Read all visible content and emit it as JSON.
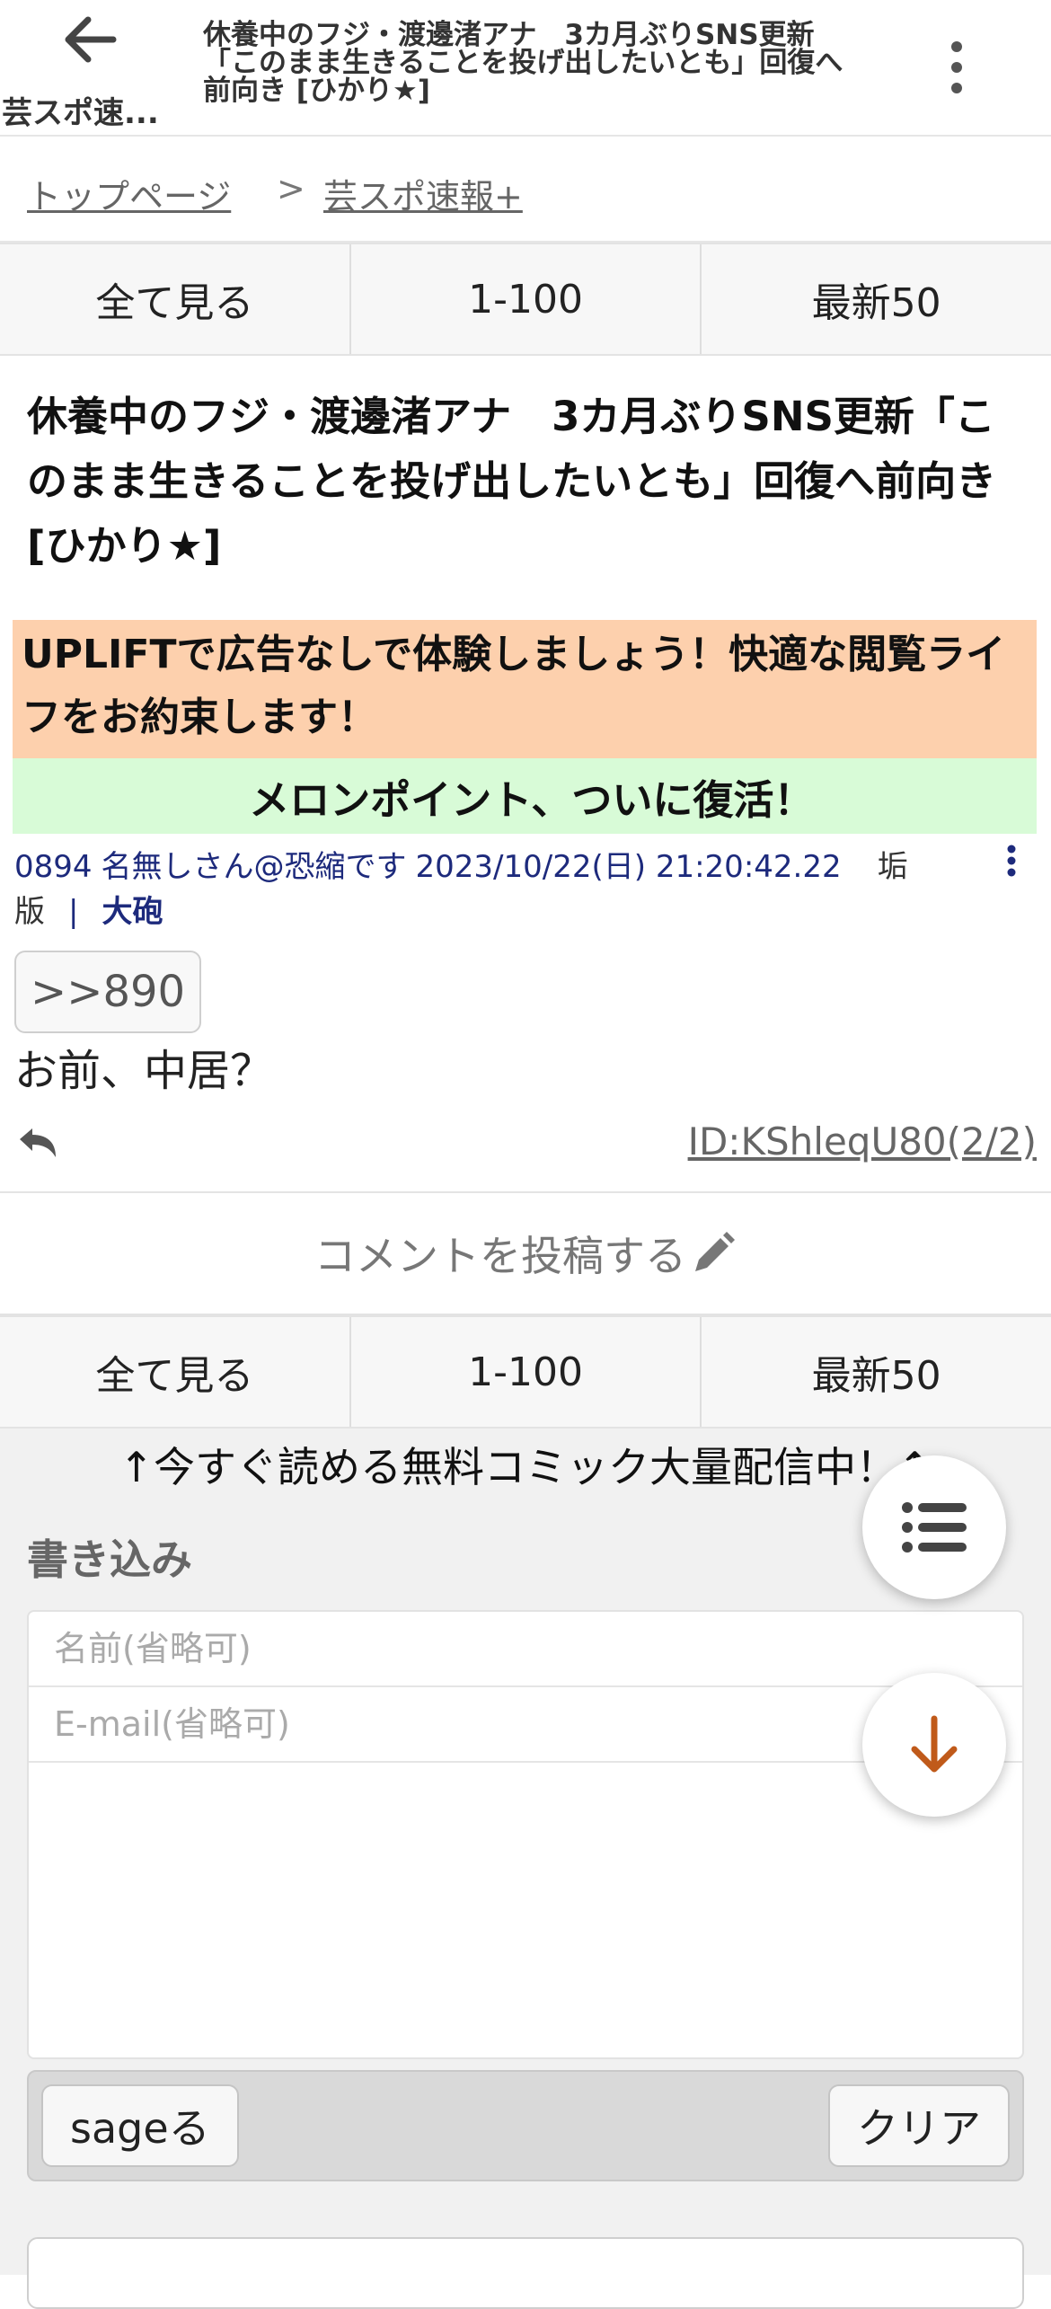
{
  "header": {
    "board_short": "芸スポ速...",
    "title": "休養中のフジ・渡邊渚アナ　3カ月ぶりSNS更新「このまま生きることを投げ出したいとも」回復へ前向き [ひかり★]"
  },
  "breadcrumb": {
    "home": "トップページ",
    "separator": ">",
    "board": "芸スポ速報+"
  },
  "nav": {
    "all": "全て見る",
    "range": "1-100",
    "latest": "最新50"
  },
  "thread": {
    "title": "休養中のフジ・渡邊渚アナ　3カ月ぶりSNS更新「このまま生きることを投げ出したいとも」回復へ前向き [ひかり★]"
  },
  "promo": {
    "uplift": "UPLIFTで広告なしで体験しましょう！快適な閲覧ライフをお約束します！",
    "melon": "󠄀󠄀 󠄀メロンポイント、ついに復活！󠄀󠄀"
  },
  "post": {
    "number": "0894",
    "name": "名無しさん@恐縮です",
    "date": "2023/10/22(日) 21:20:42.22",
    "version": "垢版",
    "sep": "|",
    "size": "大砲",
    "anchor": ">>890",
    "body": "お前、中居？",
    "id": "ID:KShleqU80(2/2)"
  },
  "comment": {
    "label": "コメントを投稿する"
  },
  "banner": {
    "comic": "↑今すぐ読める無料コミック大量配信中！↑"
  },
  "form": {
    "heading": "書き込み",
    "name_placeholder": "名前(省略可)",
    "email_placeholder": "E-mail(省略可)",
    "sage": "sageる",
    "clear": "クリア"
  },
  "colors": {
    "promo_bg": "#fdd0ad",
    "melon_bg": "#d8fbd7",
    "meta_text": "#1d2a7c",
    "accent_arrow": "#c05a1a"
  }
}
